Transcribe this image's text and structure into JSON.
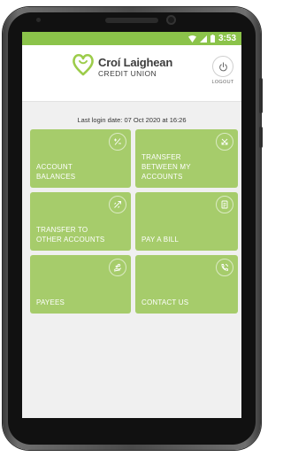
{
  "status_bar": {
    "time": "3:53"
  },
  "header": {
    "logo_name": "Croí Laighean",
    "logo_sub": "CREDIT UNION",
    "logout_label": "LOGOUT"
  },
  "last_login": "Last login date: 07 Oct 2020 at 16:26",
  "tiles": [
    {
      "label": "ACCOUNT BALANCES",
      "icon": "plus-minus-icon"
    },
    {
      "label": "TRANSFER BETWEEN MY ACCOUNTS",
      "icon": "swap-arrows-icon"
    },
    {
      "label": "TRANSFER TO OTHER ACCOUNTS",
      "icon": "transfer-arrows-icon"
    },
    {
      "label": "PAY A BILL",
      "icon": "bill-icon"
    },
    {
      "label": "PAYEES",
      "icon": "hand-coins-icon"
    },
    {
      "label": "CONTACT US",
      "icon": "phone-icon"
    }
  ],
  "colors": {
    "brand_green": "#8bc34a",
    "tile_green": "#a6cc6b"
  }
}
